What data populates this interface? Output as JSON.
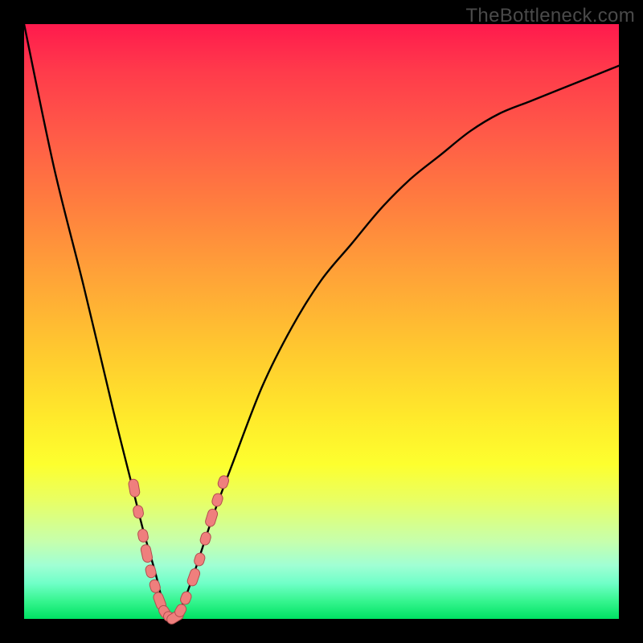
{
  "watermark": "TheBottleneck.com",
  "colors": {
    "frame": "#000000",
    "gradient_top": "#ff1a4d",
    "gradient_bottom": "#00e263",
    "curve": "#000000",
    "marker_fill": "#ef7f7d",
    "marker_stroke": "#b24e4f"
  },
  "chart_data": {
    "type": "line",
    "title": "",
    "xlabel": "",
    "ylabel": "",
    "xlim": [
      0,
      100
    ],
    "ylim": [
      0,
      100
    ],
    "note": "Axes are implicit (no printed tick labels). y represents bottleneck percentage (0 at bottom, ~100 at top). x represents hardware capability ratio index (arbitrary 0–100). Values read from the plotted curve.",
    "series": [
      {
        "name": "bottleneck-curve",
        "x": [
          0,
          5,
          10,
          15,
          18,
          20,
          22,
          23,
          24,
          25,
          26,
          28,
          30,
          32,
          35,
          40,
          45,
          50,
          55,
          60,
          65,
          70,
          75,
          80,
          85,
          90,
          95,
          100
        ],
        "y": [
          100,
          76,
          56,
          35,
          23,
          15,
          8,
          4,
          1,
          0,
          1,
          6,
          12,
          18,
          26,
          39,
          49,
          57,
          63,
          69,
          74,
          78,
          82,
          85,
          87,
          89,
          91,
          93
        ]
      }
    ],
    "markers": {
      "name": "highlighted-segment",
      "note": "Pink lozenge markers along the curve near its minimum.",
      "points": [
        {
          "x": 18.5,
          "y": 22
        },
        {
          "x": 19.2,
          "y": 18
        },
        {
          "x": 20.0,
          "y": 14
        },
        {
          "x": 20.6,
          "y": 11
        },
        {
          "x": 21.3,
          "y": 8
        },
        {
          "x": 22.0,
          "y": 5.5
        },
        {
          "x": 22.8,
          "y": 3
        },
        {
          "x": 23.6,
          "y": 1.2
        },
        {
          "x": 24.5,
          "y": 0.3
        },
        {
          "x": 25.4,
          "y": 0.3
        },
        {
          "x": 26.3,
          "y": 1.4
        },
        {
          "x": 27.2,
          "y": 3.5
        },
        {
          "x": 28.5,
          "y": 7
        },
        {
          "x": 29.5,
          "y": 10
        },
        {
          "x": 30.5,
          "y": 13.5
        },
        {
          "x": 31.5,
          "y": 17
        },
        {
          "x": 32.5,
          "y": 20
        },
        {
          "x": 33.5,
          "y": 23
        }
      ]
    }
  }
}
